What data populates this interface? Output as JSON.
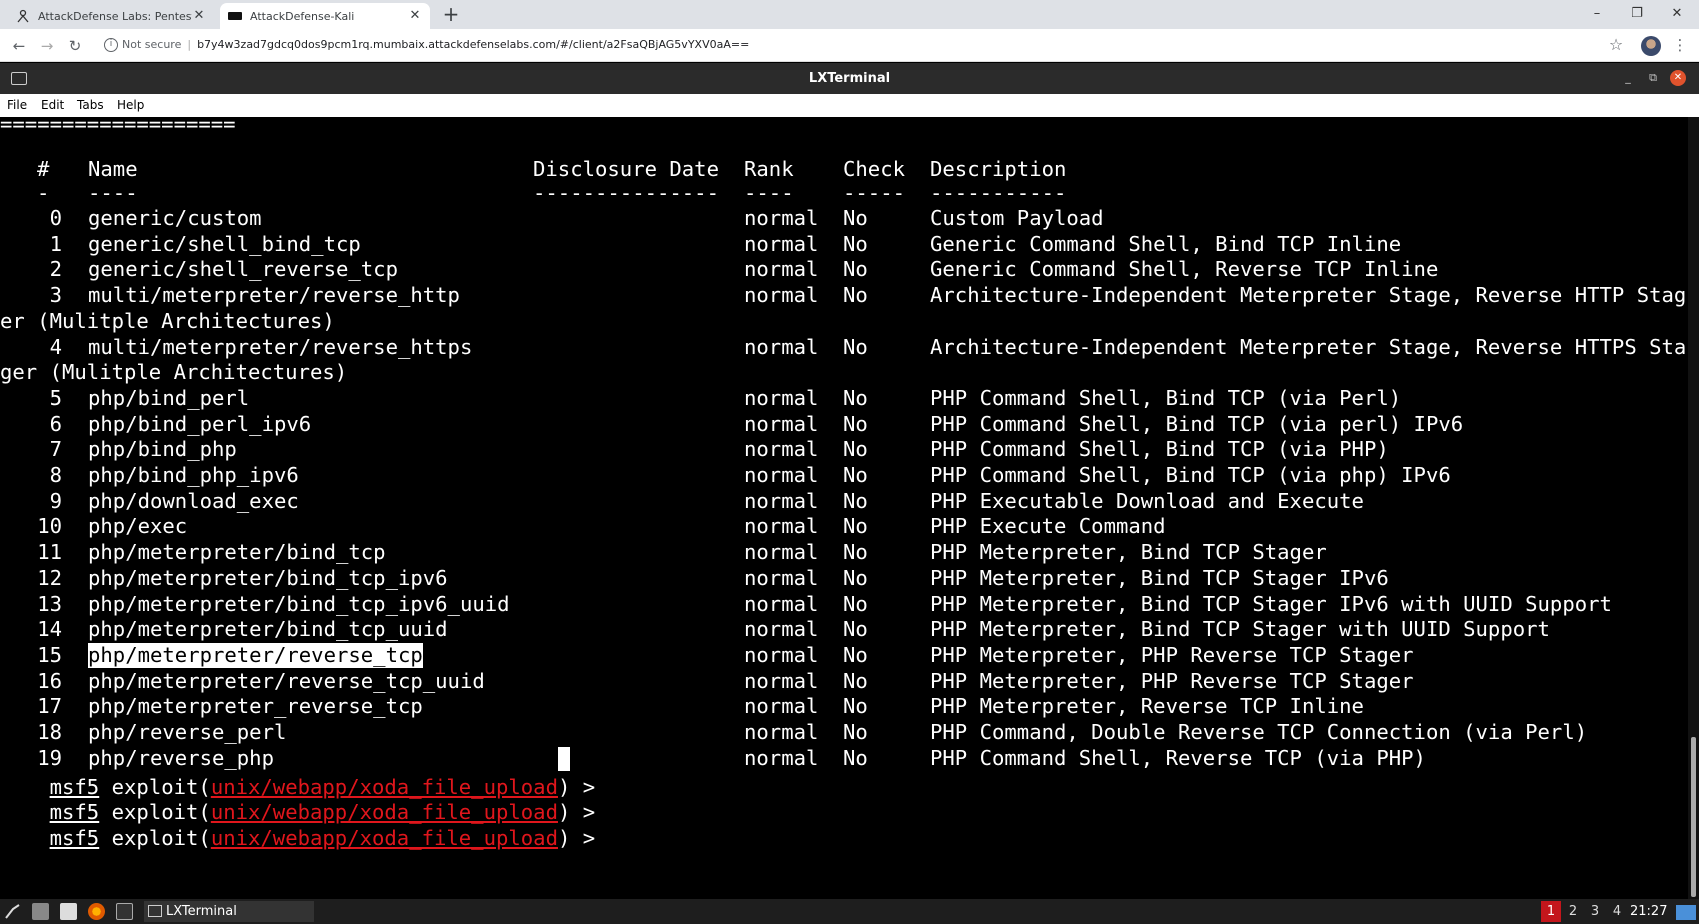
{
  "browser": {
    "tabs": [
      {
        "title": "AttackDefense Labs: Pentester A",
        "active": false,
        "icon": "person-icon"
      },
      {
        "title": "AttackDefense-Kali",
        "active": true,
        "icon": "monitor-icon"
      }
    ],
    "new_tab": "+",
    "window_controls": {
      "minimize": "–",
      "restore": "❐",
      "close": "✕"
    },
    "nav": {
      "back": "←",
      "forward": "→",
      "reload": "↻"
    },
    "address": {
      "security_label": "Not secure",
      "url": "b7y4w3zad7gdcq0dos9pcm1rq.mumbaix.attackdefenselabs.com/#/client/a2FsaQBjAG5vYXV0aA=="
    },
    "star": "☆",
    "menu": "⋮"
  },
  "terminal": {
    "title": "LXTerminal",
    "window_controls": {
      "minimize": "_",
      "maximize": "⧉",
      "close": "✕"
    },
    "menu": [
      "File",
      "Edit",
      "Tabs",
      "Help"
    ],
    "rule": "===================",
    "headers": {
      "num": "#",
      "name": "Name",
      "date": "Disclosure Date",
      "rank": "Rank",
      "check": "Check",
      "desc": "Description"
    },
    "dashes": {
      "num": "-",
      "name": "----",
      "date": "---------------",
      "rank": "----",
      "check": "-----",
      "desc": "-----------"
    },
    "rows": [
      {
        "n": "0",
        "name": "generic/custom",
        "rank": "normal",
        "check": "No",
        "desc": "Custom Payload"
      },
      {
        "n": "1",
        "name": "generic/shell_bind_tcp",
        "rank": "normal",
        "check": "No",
        "desc": "Generic Command Shell, Bind TCP Inline"
      },
      {
        "n": "2",
        "name": "generic/shell_reverse_tcp",
        "rank": "normal",
        "check": "No",
        "desc": "Generic Command Shell, Reverse TCP Inline"
      },
      {
        "n": "3",
        "name": "multi/meterpreter/reverse_http",
        "rank": "normal",
        "check": "No",
        "desc": "Architecture-Independent Meterpreter Stage, Reverse HTTP Stag",
        "wrap": "er (Mulitple Architectures)"
      },
      {
        "n": "4",
        "name": "multi/meterpreter/reverse_https",
        "rank": "normal",
        "check": "No",
        "desc": "Architecture-Independent Meterpreter Stage, Reverse HTTPS Sta",
        "wrap": "ger (Mulitple Architectures)"
      },
      {
        "n": "5",
        "name": "php/bind_perl",
        "rank": "normal",
        "check": "No",
        "desc": "PHP Command Shell, Bind TCP (via Perl)"
      },
      {
        "n": "6",
        "name": "php/bind_perl_ipv6",
        "rank": "normal",
        "check": "No",
        "desc": "PHP Command Shell, Bind TCP (via perl) IPv6"
      },
      {
        "n": "7",
        "name": "php/bind_php",
        "rank": "normal",
        "check": "No",
        "desc": "PHP Command Shell, Bind TCP (via PHP)"
      },
      {
        "n": "8",
        "name": "php/bind_php_ipv6",
        "rank": "normal",
        "check": "No",
        "desc": "PHP Command Shell, Bind TCP (via php) IPv6"
      },
      {
        "n": "9",
        "name": "php/download_exec",
        "rank": "normal",
        "check": "No",
        "desc": "PHP Executable Download and Execute"
      },
      {
        "n": "10",
        "name": "php/exec",
        "rank": "normal",
        "check": "No",
        "desc": "PHP Execute Command"
      },
      {
        "n": "11",
        "name": "php/meterpreter/bind_tcp",
        "rank": "normal",
        "check": "No",
        "desc": "PHP Meterpreter, Bind TCP Stager"
      },
      {
        "n": "12",
        "name": "php/meterpreter/bind_tcp_ipv6",
        "rank": "normal",
        "check": "No",
        "desc": "PHP Meterpreter, Bind TCP Stager IPv6"
      },
      {
        "n": "13",
        "name": "php/meterpreter/bind_tcp_ipv6_uuid",
        "rank": "normal",
        "check": "No",
        "desc": "PHP Meterpreter, Bind TCP Stager IPv6 with UUID Support"
      },
      {
        "n": "14",
        "name": "php/meterpreter/bind_tcp_uuid",
        "rank": "normal",
        "check": "No",
        "desc": "PHP Meterpreter, Bind TCP Stager with UUID Support"
      },
      {
        "n": "15",
        "name": "php/meterpreter/reverse_tcp",
        "rank": "normal",
        "check": "No",
        "desc": "PHP Meterpreter, PHP Reverse TCP Stager",
        "selected": true
      },
      {
        "n": "16",
        "name": "php/meterpreter/reverse_tcp_uuid",
        "rank": "normal",
        "check": "No",
        "desc": "PHP Meterpreter, PHP Reverse TCP Stager"
      },
      {
        "n": "17",
        "name": "php/meterpreter_reverse_tcp",
        "rank": "normal",
        "check": "No",
        "desc": "PHP Meterpreter, Reverse TCP Inline"
      },
      {
        "n": "18",
        "name": "php/reverse_perl",
        "rank": "normal",
        "check": "No",
        "desc": "PHP Command, Double Reverse TCP Connection (via Perl)"
      },
      {
        "n": "19",
        "name": "php/reverse_php",
        "rank": "normal",
        "check": "No",
        "desc": "PHP Command Shell, Reverse TCP (via PHP)"
      }
    ],
    "prompt": {
      "prefix": "msf5",
      "cmd": " exploit(",
      "module": "unix/webapp/xoda_file_upload",
      "suffix": ") > ",
      "count": 3
    }
  },
  "taskbar": {
    "task_label": "LXTerminal",
    "workspaces": [
      "1",
      "2",
      "3",
      "4"
    ],
    "active_workspace": "1",
    "clock": "21:27"
  },
  "colors": {
    "prompt_module": "#e0161c",
    "active_workspace": "#c4161c",
    "terminal_bg": "#000000"
  }
}
